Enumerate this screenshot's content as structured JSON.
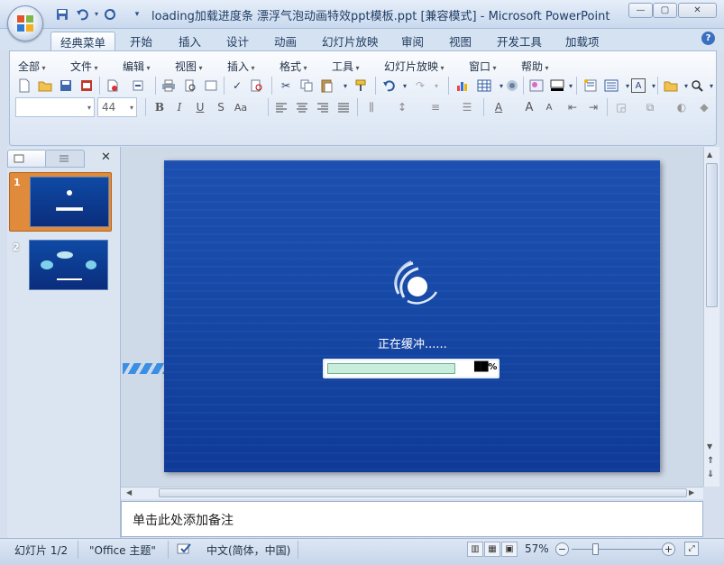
{
  "window": {
    "title": "loading加载进度条 漂浮气泡动画特效ppt模板.ppt [兼容模式] - Microsoft PowerPoint",
    "controls": {
      "minimize": "—",
      "maximize": "▢",
      "close": "✕"
    }
  },
  "quick_access": {
    "save": "save-icon",
    "undo": "undo-icon",
    "redo": "redo-icon",
    "customize": "▾"
  },
  "ribbon_tabs": [
    "经典菜单",
    "开始",
    "插入",
    "设计",
    "动画",
    "幻灯片放映",
    "审阅",
    "视图",
    "开发工具",
    "加载项"
  ],
  "menus": [
    "全部",
    "文件",
    "编辑",
    "视图",
    "插入",
    "格式",
    "工具",
    "幻灯片放映",
    "窗口",
    "帮助"
  ],
  "toolbar": {
    "font_name": "",
    "font_size": "44",
    "bold": "B",
    "italic": "I",
    "underline": "U",
    "shadow": "S",
    "font_case": "Aa",
    "font_color": "A"
  },
  "slides_panel": {
    "close": "✕",
    "thumbnails": [
      {
        "number": "1",
        "selected": true
      },
      {
        "number": "2",
        "selected": false
      }
    ]
  },
  "slide": {
    "buffering_text": "正在缓冲......",
    "progress_percent": "██%",
    "progress_fraction": 0.9
  },
  "notes": {
    "placeholder": "单击此处添加备注"
  },
  "status": {
    "slide_indicator": "幻灯片 1/2",
    "theme": "\"Office 主题\"",
    "language": "中文(简体，中国)",
    "zoom": "57%"
  },
  "colors": {
    "accent": "#1c4fb0",
    "progress_fill": "#c8eddc",
    "selected_thumb": "#e08a3c"
  }
}
